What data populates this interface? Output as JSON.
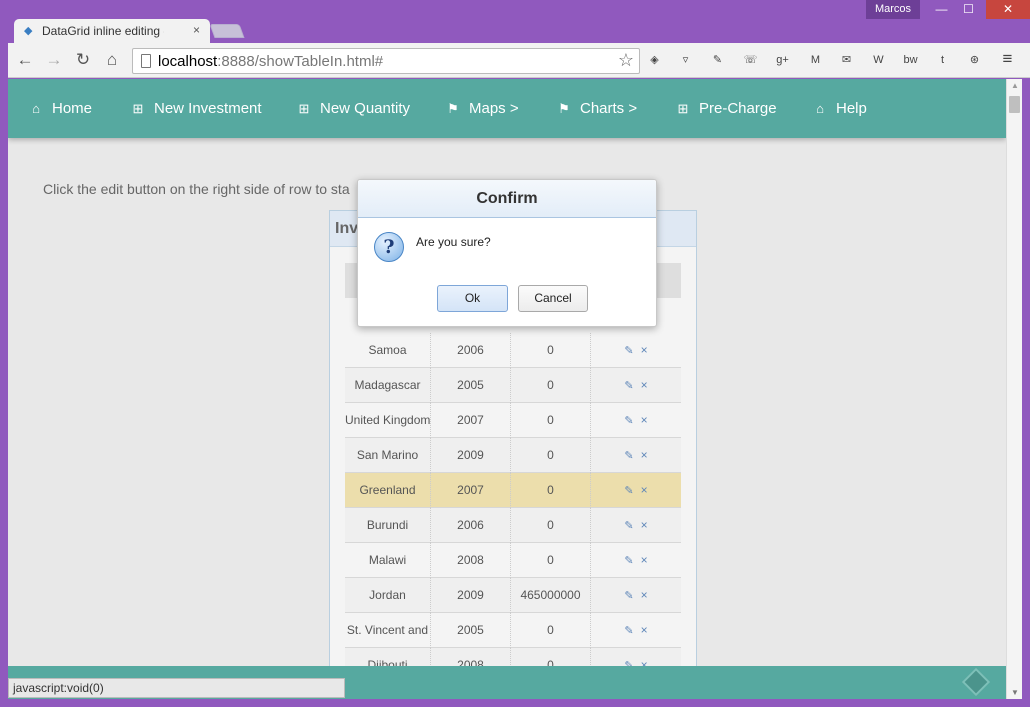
{
  "window": {
    "user": "Marcos",
    "minimize": "—",
    "maximize": "☐",
    "close": "✕"
  },
  "browser": {
    "tab_title": "DataGrid inline editing - jQ",
    "url_host": "localhost",
    "url_rest": ":8888/showTableIn.html#",
    "status_text": "javascript:void(0)",
    "extensions": [
      "feedly-icon",
      "pocket-icon",
      "evernote-icon",
      "phone-icon",
      "google-plus-icon",
      "gmail-icon",
      "mail-icon",
      "wikipedia-icon",
      "bw-icon",
      "tumblr-icon",
      "steering-icon"
    ]
  },
  "nav": {
    "items": [
      {
        "label": "Home",
        "icon": "home-icon"
      },
      {
        "label": "New Investment",
        "icon": "plus-icon"
      },
      {
        "label": "New Quantity",
        "icon": "plus-icon"
      },
      {
        "label": "Maps >",
        "icon": "flag-icon"
      },
      {
        "label": "Charts >",
        "icon": "flag-icon"
      },
      {
        "label": "Pre-Charge",
        "icon": "plus-icon"
      },
      {
        "label": "Help",
        "icon": "home-icon"
      }
    ]
  },
  "page": {
    "intro": "Click the edit button on the right side of row to sta",
    "panel_title": "Inv"
  },
  "grid": {
    "rows": [
      {
        "country": "Samoa",
        "year": "2006",
        "amount": "0"
      },
      {
        "country": "Madagascar",
        "year": "2005",
        "amount": "0"
      },
      {
        "country": "United Kingdom",
        "year": "2007",
        "amount": "0"
      },
      {
        "country": "San Marino",
        "year": "2009",
        "amount": "0"
      },
      {
        "country": "Greenland",
        "year": "2007",
        "amount": "0"
      },
      {
        "country": "Burundi",
        "year": "2006",
        "amount": "0"
      },
      {
        "country": "Malawi",
        "year": "2008",
        "amount": "0"
      },
      {
        "country": "Jordan",
        "year": "2009",
        "amount": "465000000"
      },
      {
        "country": "St. Vincent and",
        "year": "2005",
        "amount": "0"
      },
      {
        "country": "Djibouti",
        "year": "2008",
        "amount": "0"
      }
    ],
    "highlighted_row": "Greenland"
  },
  "dialog": {
    "title": "Confirm",
    "message": "Are you sure?",
    "ok_label": "Ok",
    "cancel_label": "Cancel"
  },
  "colors": {
    "window_frame": "#9059be",
    "nav_bar": "#56a9a0",
    "highlight_row": "#ecdeac"
  }
}
